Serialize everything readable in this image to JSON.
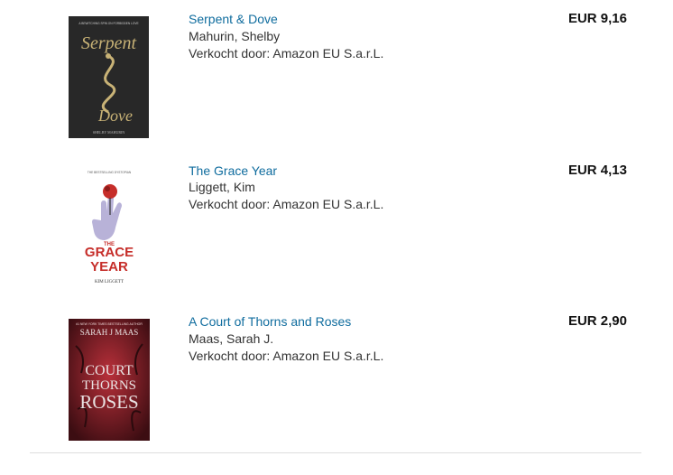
{
  "items": [
    {
      "title": "Serpent & Dove",
      "author": "Mahurin, Shelby",
      "seller": "Verkocht door: Amazon EU S.a.r.L.",
      "price": "EUR 9,16",
      "cover": {
        "tagline": "A BEWITCHING SPIN ON FORBIDDEN LOVE",
        "title_line1": "Serpent",
        "title_line2": "Dove",
        "author": "SHELBY MAHURIN",
        "colors": {
          "bg": "#2f2f2f",
          "accent": "#c8b276"
        }
      }
    },
    {
      "title": "The Grace Year",
      "author": "Liggett, Kim",
      "seller": "Verkocht door: Amazon EU S.a.r.L.",
      "price": "EUR 4,13",
      "cover": {
        "tagline": "THE BESTSELLING DYSTOPIAN",
        "title_line1": "THE",
        "title_line2": "GRACE",
        "title_line3": "YEAR",
        "author": "KIM LIGGETT",
        "colors": {
          "bg": "#ffffff",
          "accent": "#c62e2a",
          "hand": "#b8b2d8"
        }
      }
    },
    {
      "title": "A Court of Thorns and Roses",
      "author": "Maas, Sarah J.",
      "seller": "Verkocht door: Amazon EU S.a.r.L.",
      "price": "EUR 2,90",
      "cover": {
        "tagline": "#1 NEW YORK TIMES BESTSELLING AUTHOR",
        "author": "SARAH J MAAS",
        "title_line1": "COURT",
        "title_line2": "THORNS",
        "title_line3": "ROSES",
        "colors": {
          "bg": "#7a1a22",
          "accent": "#e9e2e2"
        }
      }
    }
  ]
}
